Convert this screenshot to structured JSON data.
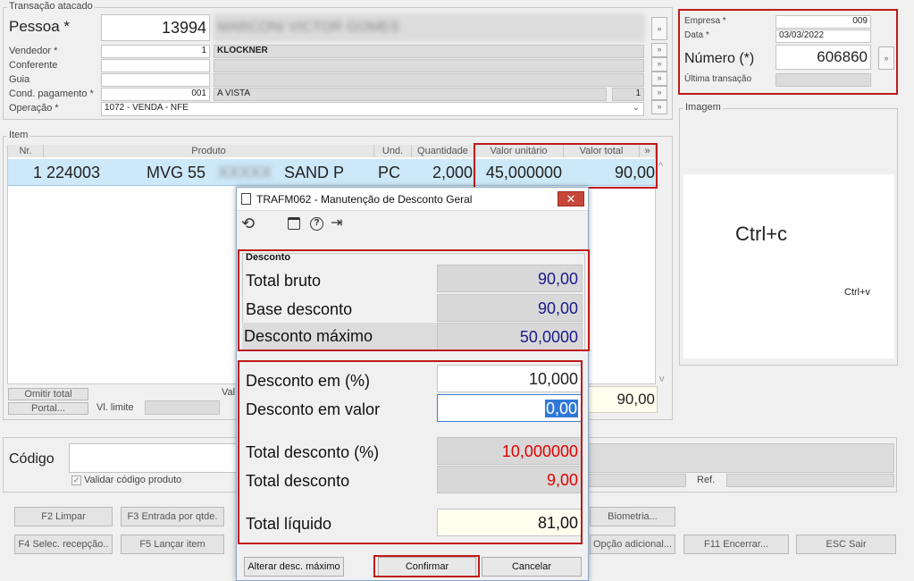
{
  "transacao": {
    "legend": "Transação atacado",
    "pessoa_label": "Pessoa *",
    "pessoa_code": "13994",
    "pessoa_name": "MARCONI VICTOR GOMES",
    "vendedor_label": "Vendedor *",
    "vendedor_code": "1",
    "vendedor_name": "KLOCKNER",
    "conferente_label": "Conferente",
    "guia_label": "Guia",
    "cond_label": "Cond. pagamento *",
    "cond_code": "001",
    "cond_name": "A VISTA",
    "cond_extra": "1",
    "operacao_label": "Operação *",
    "operacao_value": "1072 - VENDA - NFE"
  },
  "empresa": {
    "empresa_label": "Empresa *",
    "empresa_value": "009",
    "data_label": "Data *",
    "data_value": "03/03/2022",
    "numero_label": "Número (*)",
    "numero_value": "606860",
    "ultima_label": "Última transação"
  },
  "imagem": {
    "legend": "Imagem",
    "big_text": "Ctrl+c",
    "small_text": "Ctrl+v"
  },
  "item": {
    "legend": "Item",
    "headers": [
      "Nr.",
      "Produto",
      "Und.",
      "Quantidade",
      "Valor unitário",
      "Valor total"
    ],
    "row": {
      "nr": "1",
      "codigo": "224003",
      "produto_a": "MVG 55",
      "produto_b": "XXXXX",
      "produto_c": "SAND P",
      "und": "PC",
      "quantidade": "2,000",
      "valor_unitario": "45,000000",
      "valor_total": "90,00"
    },
    "omitir_total": "Omitir total",
    "portal": "Portal...",
    "vl_limite": "Vl. limite",
    "valor_partial": "Val",
    "total_value": "90,00"
  },
  "codigo": {
    "label": "Código",
    "validar": "Validar código produto",
    "ref_label": "Ref."
  },
  "buttons": {
    "f2": "F2 Limpar",
    "f3": "F3 Entrada por qtde.",
    "biometria": "Biometria...",
    "f4": "F4 Selec. recepção..",
    "f5": "F5 Lançar item",
    "opcao": "Opção adicional...",
    "f11": "F11 Encerrar...",
    "esc": "ESC Sair"
  },
  "dialog": {
    "title": "TRAFM062 - Manutenção de Desconto Geral",
    "close": "✕",
    "group_legend": "Desconto",
    "total_bruto_label": "Total bruto",
    "total_bruto": "90,00",
    "base_desconto_label": "Base desconto",
    "base_desconto": "90,00",
    "desconto_maximo_label": "Desconto máximo",
    "desconto_maximo": "50,0000",
    "desconto_pct_label": "Desconto em (%)",
    "desconto_pct": "10,000",
    "desconto_valor_label": "Desconto em valor",
    "desconto_valor": "0,00",
    "total_desconto_pct_label": "Total desconto (%)",
    "total_desconto_pct": "10,000000",
    "total_desconto_label": "Total desconto",
    "total_desconto": "9,00",
    "total_liquido_label": "Total líquido",
    "total_liquido": "81,00",
    "alterar_btn": "Alterar desc. máximo",
    "confirmar_btn": "Confirmar",
    "cancelar_btn": "Cancelar"
  },
  "colors": {
    "highlight_red": "#c01a1a",
    "row_selected": "#cde8f8",
    "navy_value": "#1a1a8c",
    "red_value": "#e00000"
  }
}
